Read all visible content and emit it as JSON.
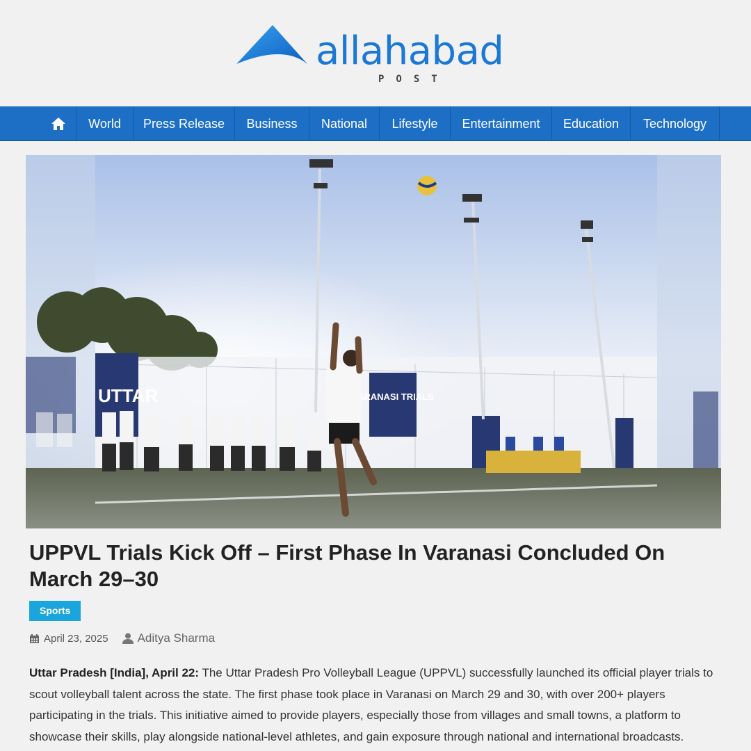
{
  "logo": {
    "word": "allahabad",
    "sub": "POST"
  },
  "nav": {
    "items": [
      {
        "label": "World"
      },
      {
        "label": "Press Release"
      },
      {
        "label": "Business"
      },
      {
        "label": "National"
      },
      {
        "label": "Lifestyle"
      },
      {
        "label": "Entertainment"
      },
      {
        "label": "Education"
      },
      {
        "label": "Technology"
      }
    ]
  },
  "hero": {
    "banner_left": "UTTAR",
    "banner_center": "VARANASI TRIALS"
  },
  "article": {
    "title": "UPPVL Trials Kick Off – First Phase In Varanasi Concluded On March 29–30",
    "category": "Sports",
    "date": "April 23, 2025",
    "author": "Aditya Sharma",
    "lead": "Uttar Pradesh [India], April 22:",
    "body": " The Uttar Pradesh Pro Volleyball League (UPPVL) successfully launched its official player trials to scout volleyball talent across the state. The first phase took place in Varanasi on March 29 and 30, with over 200+ players participating in the trials. This initiative aimed to provide players, especially those from villages and small towns, a platform to showcase their skills, play alongside national-level athletes, and gain exposure through national and international broadcasts."
  },
  "colors": {
    "brand_blue": "#1b78d4",
    "nav_blue": "#1d6fc6",
    "badge_blue": "#1aa5dc"
  }
}
